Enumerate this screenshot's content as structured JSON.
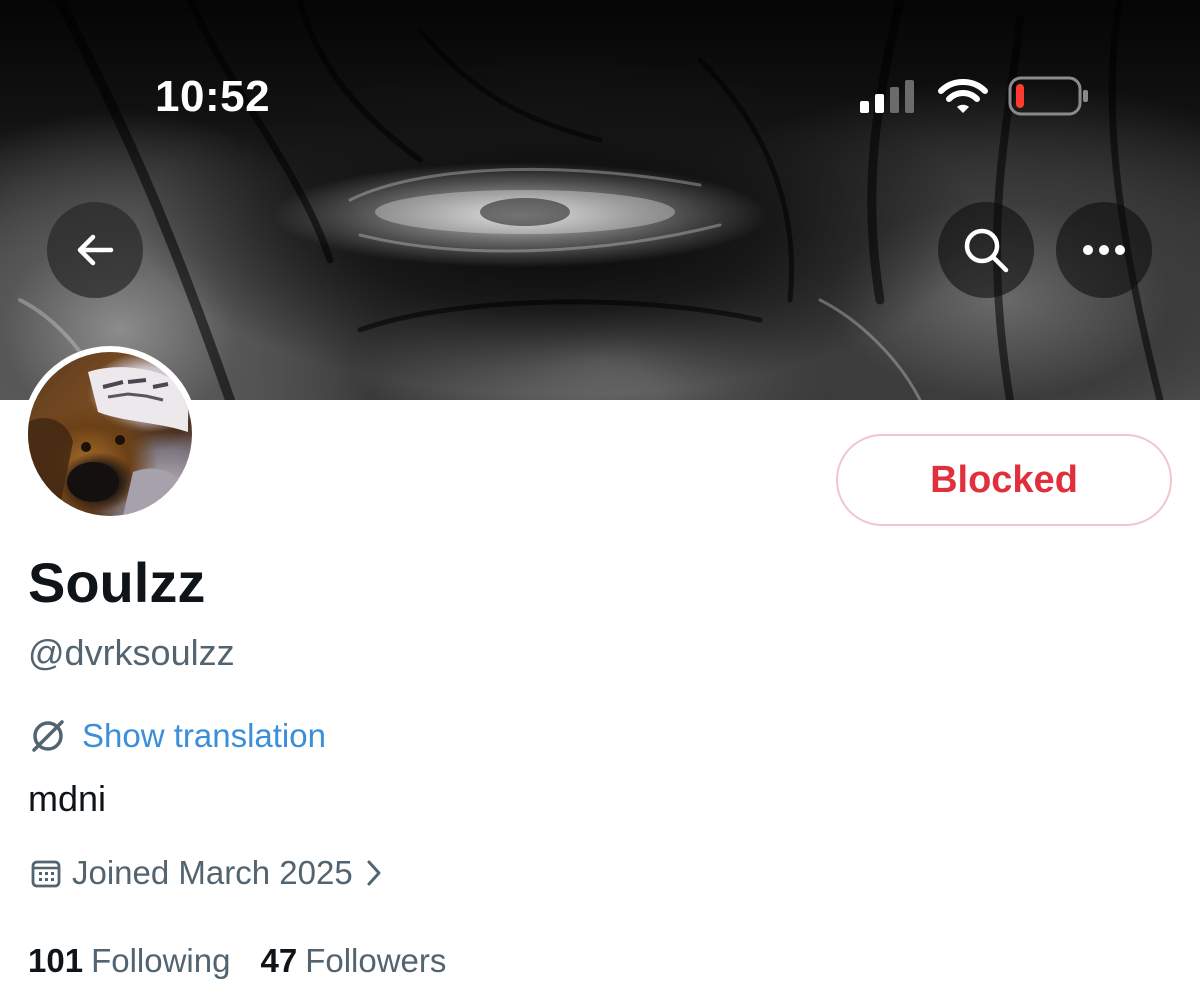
{
  "status_bar": {
    "time": "10:52",
    "signal_icon": "cellular-signal-icon",
    "wifi_icon": "wifi-icon",
    "battery_icon": "battery-low-icon",
    "battery_level": 0.1,
    "battery_color": "#ff3b30"
  },
  "header": {
    "back_icon": "arrow-left-icon",
    "search_icon": "search-icon",
    "more_icon": "more-horizontal-icon"
  },
  "profile": {
    "display_name": "Soulzz",
    "handle": "@dvrksoulzz",
    "translation_label": "Show translation",
    "translation_icon": "translate-globe-icon",
    "bio": "mdni",
    "joined_label": "Joined March 2025",
    "joined_icon": "calendar-icon",
    "joined_chevron_icon": "chevron-right-icon"
  },
  "actions": {
    "blocked_label": "Blocked",
    "blocked_color": "#e0303d"
  },
  "stats": {
    "following_count": "101",
    "following_label": "Following",
    "followers_count": "47",
    "followers_label": "Followers"
  },
  "colors": {
    "link": "#3b8ed9",
    "secondary_text": "#536471",
    "primary_text": "#0f1419"
  }
}
